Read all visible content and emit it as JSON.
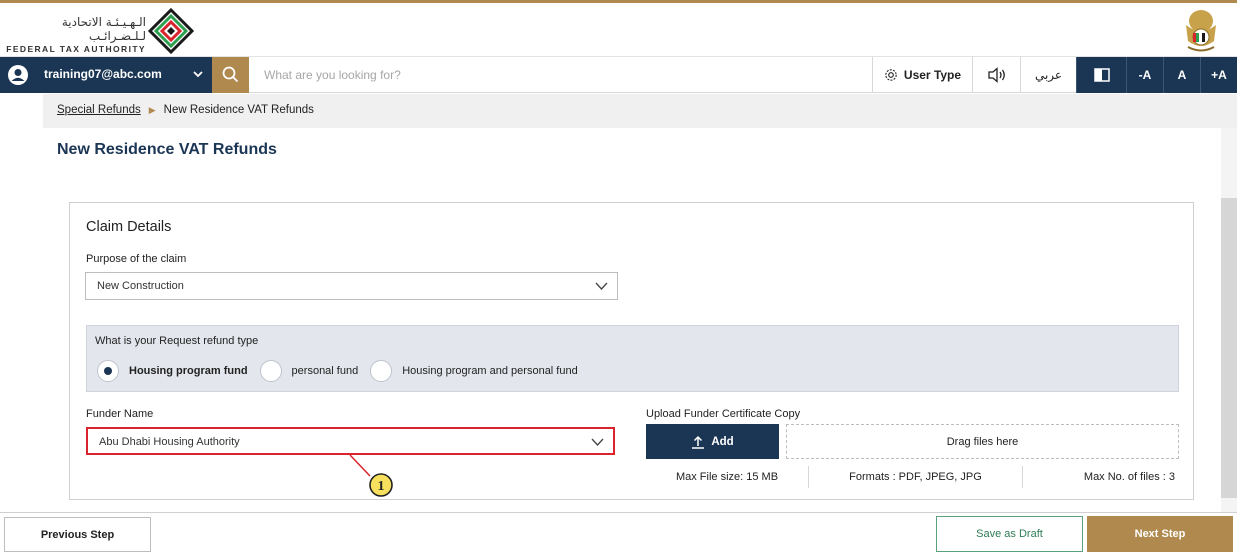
{
  "header": {
    "logo_arabic": "الـهـيـئـة الاتحادية لـلـضـرائـب",
    "logo_english": "FEDERAL TAX AUTHORITY"
  },
  "navbar": {
    "user_email": "training07@abc.com",
    "search_placeholder": "What are you looking for?",
    "user_type_label": "User Type",
    "language_label": "عربي",
    "font_decrease_label": "-A",
    "font_normal_label": "A",
    "font_increase_label": "+A"
  },
  "breadcrumb": {
    "parent": "Special Refunds",
    "current": "New Residence VAT Refunds"
  },
  "page_title": "New Residence VAT Refunds",
  "claim_details": {
    "title": "Claim Details",
    "purpose_label": "Purpose of the claim",
    "purpose_value": "New Construction",
    "refund_type_question": "What is your Request refund type",
    "refund_options": [
      {
        "label": "Housing program fund",
        "selected": true
      },
      {
        "label": "personal fund",
        "selected": false
      },
      {
        "label": "Housing program and personal fund",
        "selected": false
      }
    ],
    "funder_label": "Funder Name",
    "funder_value": "Abu Dhabi Housing Authority",
    "upload_label": "Upload Funder Certificate Copy",
    "add_button": "Add",
    "dropzone_text": "Drag files here",
    "max_file_size": "Max File size: 15 MB",
    "formats": "Formats : PDF, JPEG, JPG",
    "max_files": "Max No. of files : 3"
  },
  "callout": {
    "number": "1"
  },
  "footer": {
    "previous_label": "Previous Step",
    "draft_label": "Save as Draft",
    "next_label": "Next Step"
  },
  "colors": {
    "navy": "#1b3654",
    "gold": "#b0894f",
    "highlight_red": "#d9232d",
    "draft_green": "#2e7d55",
    "callout_yellow": "#f6e05e"
  },
  "icons": [
    "user-avatar-icon",
    "chevron-down-icon",
    "search-icon",
    "gear-icon",
    "speaker-icon",
    "contrast-icon",
    "upload-icon",
    "fta-logo",
    "uae-emblem"
  ]
}
